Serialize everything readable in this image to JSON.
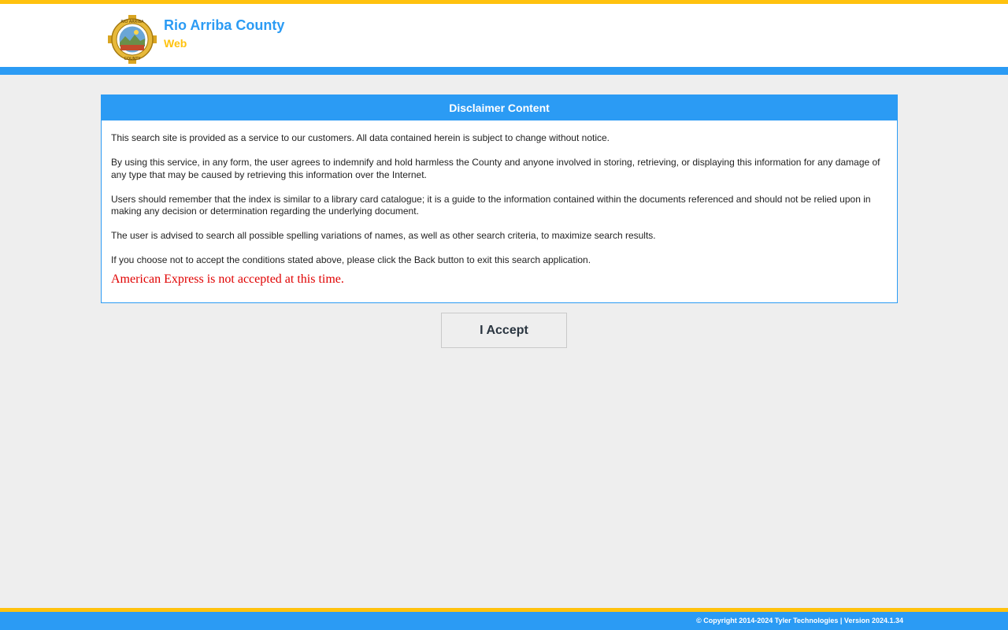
{
  "header": {
    "title": "Rio Arriba County",
    "subtitle": "Web",
    "logo_icon": "county-seal-icon",
    "logo_text_top": "RIO ARRIBA",
    "logo_text_bottom": "COUNTY",
    "colors": {
      "brand_blue": "#2b9bf4",
      "brand_gold": "#ffc20e"
    }
  },
  "disclaimer": {
    "heading": "Disclaimer Content",
    "paragraphs": [
      "This search site is provided as a service to our customers. All data contained herein is subject to change without notice.",
      "By using this service, in any form, the user agrees to indemnify and hold harmless the County and anyone involved in storing, retrieving, or displaying this information for any damage of any type that may be caused by retrieving this information over the Internet.",
      "Users should remember that the index is similar to a library card catalogue; it is a guide to the information contained within the documents referenced and should not be relied upon in making any decision or determination regarding the underlying document.",
      "The user is advised to search all possible spelling variations of names, as well as other search criteria, to maximize search results.",
      "If you choose not to accept the conditions stated above, please click the Back button to exit this search application."
    ],
    "notice": "American Express is not accepted at this time.",
    "notice_color": "#e00000"
  },
  "actions": {
    "accept_label": "I Accept"
  },
  "footer": {
    "copyright": "© Copyright 2014-2024 Tyler Technologies | Version 2024.1.34"
  }
}
